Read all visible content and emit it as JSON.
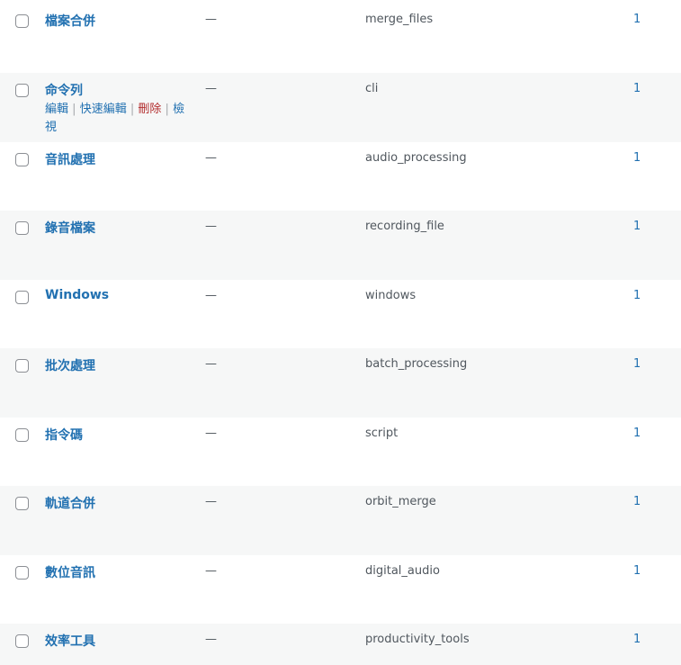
{
  "rows": [
    {
      "name": "檔案合併",
      "description": "—",
      "slug": "merge_files",
      "count": "1"
    },
    {
      "name": "命令列",
      "description": "—",
      "slug": "cli",
      "count": "1",
      "actions": {
        "edit": "編輯",
        "quick_edit": "快速編輯",
        "delete": "刪除",
        "view": "檢視",
        "sep": "|"
      }
    },
    {
      "name": "音訊處理",
      "description": "—",
      "slug": "audio_processing",
      "count": "1"
    },
    {
      "name": "錄音檔案",
      "description": "—",
      "slug": "recording_file",
      "count": "1"
    },
    {
      "name": "Windows",
      "description": "—",
      "slug": "windows",
      "count": "1"
    },
    {
      "name": "批次處理",
      "description": "—",
      "slug": "batch_processing",
      "count": "1"
    },
    {
      "name": "指令碼",
      "description": "—",
      "slug": "script",
      "count": "1"
    },
    {
      "name": "軌道合併",
      "description": "—",
      "slug": "orbit_merge",
      "count": "1"
    },
    {
      "name": "數位音訊",
      "description": "—",
      "slug": "digital_audio",
      "count": "1"
    },
    {
      "name": "效率工具",
      "description": "—",
      "slug": "productivity_tools",
      "count": "1"
    }
  ]
}
